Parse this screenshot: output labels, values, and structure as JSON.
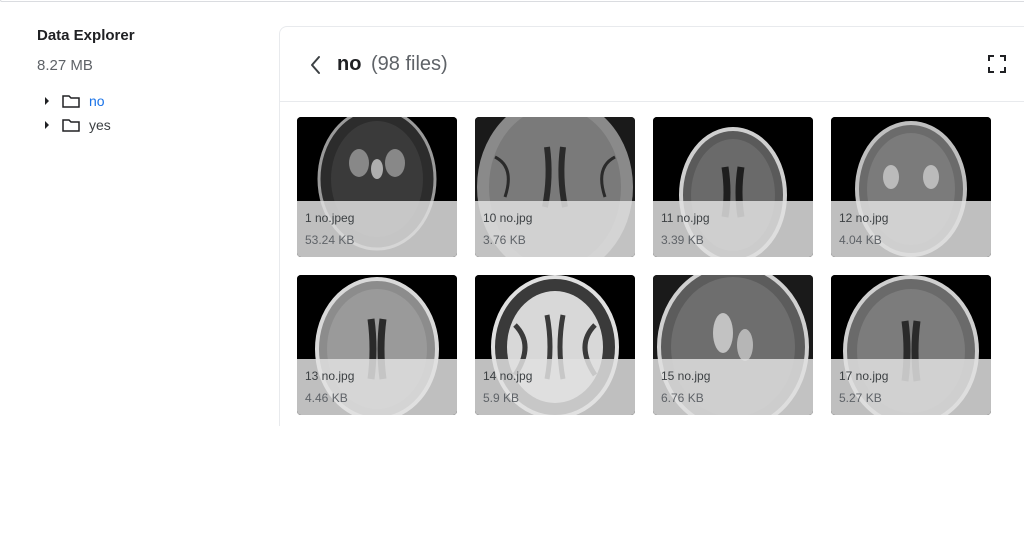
{
  "sidebar": {
    "title": "Data Explorer",
    "size": "8.27 MB",
    "items": [
      {
        "label": "no",
        "active": true,
        "icon": "folder-icon"
      },
      {
        "label": "yes",
        "active": false,
        "icon": "folder-icon"
      }
    ]
  },
  "header": {
    "name": "no",
    "count": "(98 files)",
    "back_icon": "chevron-left-icon",
    "expand_icon": "fullscreen-icon"
  },
  "files": [
    {
      "name": "1 no.jpeg",
      "size": "53.24 KB"
    },
    {
      "name": "10 no.jpg",
      "size": "3.76 KB"
    },
    {
      "name": "11 no.jpg",
      "size": "3.39 KB"
    },
    {
      "name": "12 no.jpg",
      "size": "4.04 KB"
    },
    {
      "name": "13 no.jpg",
      "size": "4.46 KB"
    },
    {
      "name": "14 no.jpg",
      "size": "5.9 KB"
    },
    {
      "name": "15 no.jpg",
      "size": "6.76 KB"
    },
    {
      "name": "17 no.jpg",
      "size": "5.27 KB"
    }
  ]
}
